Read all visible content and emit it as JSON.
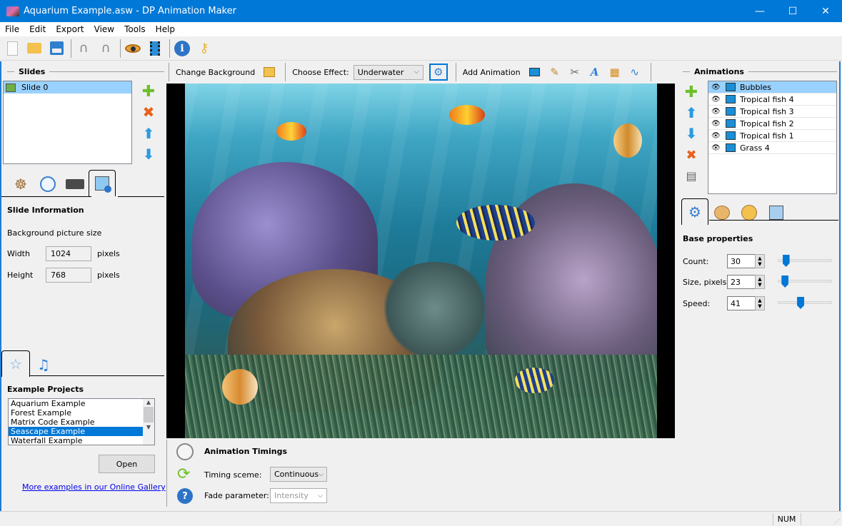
{
  "window": {
    "title": "Aquarium Example.asw - DP Animation Maker",
    "minimize": "—",
    "maximize": "☐",
    "close": "✕"
  },
  "menu": [
    "File",
    "Edit",
    "Export",
    "View",
    "Tools",
    "Help"
  ],
  "toolbar": {
    "icons": [
      "new-file-icon",
      "open-folder-icon",
      "save-icon",
      "undo-icon",
      "redo-icon",
      "preview-eye-icon",
      "export-video-icon",
      "info-icon",
      "key-icon"
    ]
  },
  "slides": {
    "title": "Slides",
    "items": [
      {
        "label": "Slide 0",
        "selected": true
      }
    ]
  },
  "left_tabs": [
    "settings-wheel-icon",
    "clock-icon",
    "camera-icon",
    "slide-info-icon"
  ],
  "slide_info": {
    "title": "Slide Information",
    "subtitle": "Background picture size",
    "width_label": "Width",
    "width_value": "1024",
    "height_label": "Height",
    "height_value": "768",
    "unit": "pixels"
  },
  "bottom_tabs": [
    "star-icon",
    "music-icon"
  ],
  "examples": {
    "title": "Example Projects",
    "items": [
      {
        "label": "Aquarium Example",
        "selected": false
      },
      {
        "label": "Forest Example",
        "selected": false
      },
      {
        "label": "Matrix Code Example",
        "selected": false
      },
      {
        "label": "Seascape Example",
        "selected": true
      },
      {
        "label": "Waterfall Example",
        "selected": false
      }
    ],
    "open_button": "Open",
    "gallery_link": "More examples in our Online Gallery"
  },
  "effects_bar": {
    "change_background": "Change Background",
    "choose_effect_label": "Choose Effect:",
    "effect_value": "Underwater",
    "add_animation": "Add Animation"
  },
  "timings": {
    "title": "Animation Timings",
    "timing_label": "Timing sceme:",
    "timing_value": "Continuous",
    "fade_label": "Fade parameter:",
    "fade_value": "Intensity"
  },
  "animations": {
    "title": "Animations",
    "items": [
      {
        "label": "Bubbles",
        "selected": true
      },
      {
        "label": "Tropical fish 4",
        "selected": false
      },
      {
        "label": "Tropical fish 3",
        "selected": false
      },
      {
        "label": "Tropical fish 2",
        "selected": false
      },
      {
        "label": "Tropical fish 1",
        "selected": false
      },
      {
        "label": "Grass 4",
        "selected": false
      }
    ]
  },
  "right_tabs": [
    "base-properties-gear-icon",
    "palette-icon",
    "compass-icon",
    "frame-icon"
  ],
  "base_properties": {
    "title": "Base properties",
    "count_label": "Count:",
    "count_value": "30",
    "count_slider": 0.1,
    "size_label": "Size, pixels:",
    "size_value": "23",
    "size_slider": 0.08,
    "speed_label": "Speed:",
    "speed_value": "41",
    "speed_slider": 0.41
  },
  "status": {
    "num": "NUM"
  }
}
